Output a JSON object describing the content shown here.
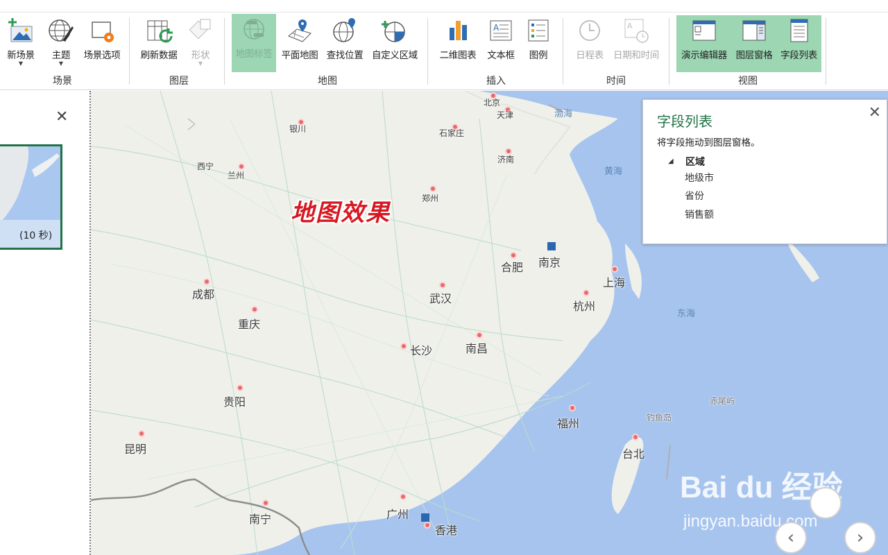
{
  "ribbon": {
    "buttons": [
      {
        "id": "new-scene",
        "label": "新场景",
        "dropdown": true
      },
      {
        "id": "theme",
        "label": "主题",
        "dropdown": true
      },
      {
        "id": "scene-options",
        "label": "场景选项"
      },
      {
        "id": "refresh-data",
        "label": "刷新数据"
      },
      {
        "id": "shapes",
        "label": "形状",
        "dropdown": true,
        "disabled": true
      },
      {
        "id": "map-labels",
        "label": "地图标签",
        "active": true
      },
      {
        "id": "flat-map",
        "label": "平面地图"
      },
      {
        "id": "find-location",
        "label": "查找位置"
      },
      {
        "id": "custom-region",
        "label": "自定义区域"
      },
      {
        "id": "2d-chart",
        "label": "二维图表"
      },
      {
        "id": "text-box",
        "label": "文本框"
      },
      {
        "id": "legend",
        "label": "图例"
      },
      {
        "id": "timeline",
        "label": "日程表",
        "disabled": true
      },
      {
        "id": "date-time",
        "label": "日期和时间",
        "disabled": true
      },
      {
        "id": "tour-editor",
        "label": "演示编辑器",
        "active": true
      },
      {
        "id": "layer-pane",
        "label": "图层窗格",
        "active": true
      },
      {
        "id": "field-list",
        "label": "字段列表",
        "active": true
      }
    ],
    "groups": [
      "场景",
      "图层",
      "地图",
      "插入",
      "时间",
      "视图"
    ]
  },
  "tour_pane": {
    "close_symbol": "✕",
    "scene_duration": "(10 秒)"
  },
  "map": {
    "caption": "地图效果",
    "cities": [
      "北京",
      "天津",
      "石家庄",
      "银川",
      "西宁",
      "兰州",
      "济南",
      "郑州",
      "合肥",
      "南京",
      "上海",
      "杭州",
      "成都",
      "重庆",
      "武汉",
      "长沙",
      "南昌",
      "贵阳",
      "福州",
      "昆明",
      "台北",
      "南宁",
      "广州",
      "香港"
    ],
    "seas": [
      "渤海",
      "黄海",
      "东海"
    ],
    "islands": [
      "钓鱼岛",
      "赤尾屿"
    ]
  },
  "field_list": {
    "title": "字段列表",
    "hint": "将字段拖动到图层窗格。",
    "group": "区域",
    "fields": [
      "地级市",
      "省份",
      "销售额"
    ]
  },
  "nav": {
    "prev": "‹",
    "next": "›"
  },
  "watermark": {
    "brand": "Bai du 经验",
    "url": "jingyan.baidu.com"
  },
  "colors": {
    "accent": "#217346",
    "active_bg": "#9cd6b3",
    "pin": "#e8696b",
    "sea": "#a9c6ec",
    "caption": "#d51922"
  }
}
